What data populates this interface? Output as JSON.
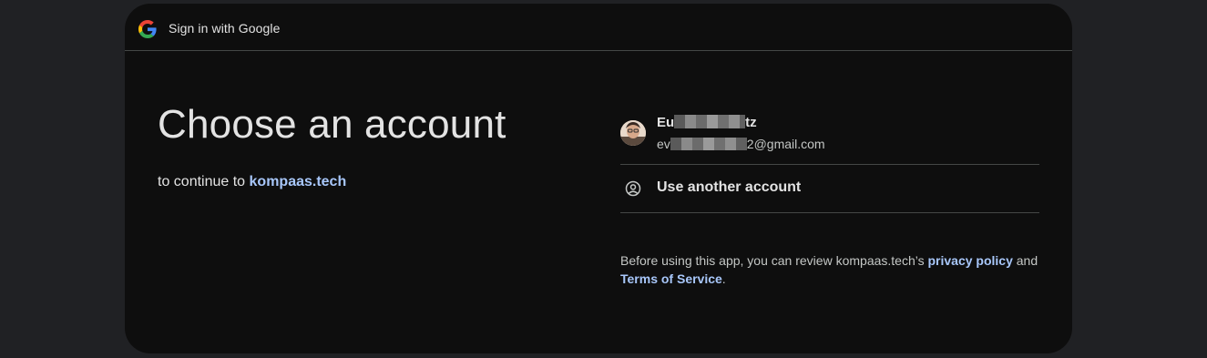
{
  "topbar": {
    "logo_icon": "google-g-icon",
    "title": "Sign in with Google"
  },
  "main": {
    "heading": "Choose an account",
    "subtitle_prefix": "to continue to ",
    "subtitle_link": "kompaas.tech"
  },
  "accounts": [
    {
      "name_start": "Eu",
      "name_end": "tz",
      "email_start": "ev",
      "email_end": "2@gmail.com",
      "avatar_icon": "user-avatar"
    }
  ],
  "use_another": {
    "icon": "account-circle-icon",
    "label": "Use another account"
  },
  "footer": {
    "text_before": "Before using this app, you can review kompaas.tech’s ",
    "privacy_link": "privacy policy",
    "text_middle": " and ",
    "terms_link": "Terms of Service",
    "text_after": "."
  },
  "colors": {
    "background": "#202124",
    "card": "#0e0e0e",
    "link": "#a8c7fa",
    "divider": "#444746"
  }
}
